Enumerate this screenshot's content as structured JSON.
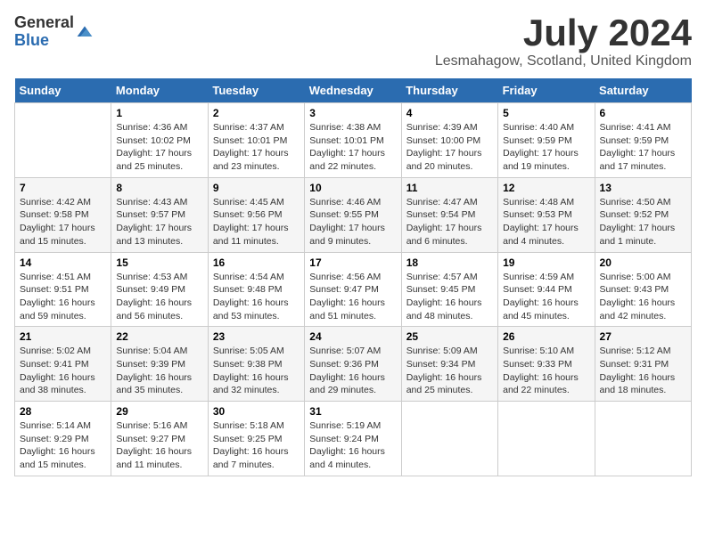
{
  "logo": {
    "general": "General",
    "blue": "Blue"
  },
  "title": "July 2024",
  "location": "Lesmahagow, Scotland, United Kingdom",
  "days_header": [
    "Sunday",
    "Monday",
    "Tuesday",
    "Wednesday",
    "Thursday",
    "Friday",
    "Saturday"
  ],
  "weeks": [
    [
      {
        "day": "",
        "sunrise": "",
        "sunset": "",
        "daylight": ""
      },
      {
        "day": "1",
        "sunrise": "Sunrise: 4:36 AM",
        "sunset": "Sunset: 10:02 PM",
        "daylight": "Daylight: 17 hours and 25 minutes."
      },
      {
        "day": "2",
        "sunrise": "Sunrise: 4:37 AM",
        "sunset": "Sunset: 10:01 PM",
        "daylight": "Daylight: 17 hours and 23 minutes."
      },
      {
        "day": "3",
        "sunrise": "Sunrise: 4:38 AM",
        "sunset": "Sunset: 10:01 PM",
        "daylight": "Daylight: 17 hours and 22 minutes."
      },
      {
        "day": "4",
        "sunrise": "Sunrise: 4:39 AM",
        "sunset": "Sunset: 10:00 PM",
        "daylight": "Daylight: 17 hours and 20 minutes."
      },
      {
        "day": "5",
        "sunrise": "Sunrise: 4:40 AM",
        "sunset": "Sunset: 9:59 PM",
        "daylight": "Daylight: 17 hours and 19 minutes."
      },
      {
        "day": "6",
        "sunrise": "Sunrise: 4:41 AM",
        "sunset": "Sunset: 9:59 PM",
        "daylight": "Daylight: 17 hours and 17 minutes."
      }
    ],
    [
      {
        "day": "7",
        "sunrise": "Sunrise: 4:42 AM",
        "sunset": "Sunset: 9:58 PM",
        "daylight": "Daylight: 17 hours and 15 minutes."
      },
      {
        "day": "8",
        "sunrise": "Sunrise: 4:43 AM",
        "sunset": "Sunset: 9:57 PM",
        "daylight": "Daylight: 17 hours and 13 minutes."
      },
      {
        "day": "9",
        "sunrise": "Sunrise: 4:45 AM",
        "sunset": "Sunset: 9:56 PM",
        "daylight": "Daylight: 17 hours and 11 minutes."
      },
      {
        "day": "10",
        "sunrise": "Sunrise: 4:46 AM",
        "sunset": "Sunset: 9:55 PM",
        "daylight": "Daylight: 17 hours and 9 minutes."
      },
      {
        "day": "11",
        "sunrise": "Sunrise: 4:47 AM",
        "sunset": "Sunset: 9:54 PM",
        "daylight": "Daylight: 17 hours and 6 minutes."
      },
      {
        "day": "12",
        "sunrise": "Sunrise: 4:48 AM",
        "sunset": "Sunset: 9:53 PM",
        "daylight": "Daylight: 17 hours and 4 minutes."
      },
      {
        "day": "13",
        "sunrise": "Sunrise: 4:50 AM",
        "sunset": "Sunset: 9:52 PM",
        "daylight": "Daylight: 17 hours and 1 minute."
      }
    ],
    [
      {
        "day": "14",
        "sunrise": "Sunrise: 4:51 AM",
        "sunset": "Sunset: 9:51 PM",
        "daylight": "Daylight: 16 hours and 59 minutes."
      },
      {
        "day": "15",
        "sunrise": "Sunrise: 4:53 AM",
        "sunset": "Sunset: 9:49 PM",
        "daylight": "Daylight: 16 hours and 56 minutes."
      },
      {
        "day": "16",
        "sunrise": "Sunrise: 4:54 AM",
        "sunset": "Sunset: 9:48 PM",
        "daylight": "Daylight: 16 hours and 53 minutes."
      },
      {
        "day": "17",
        "sunrise": "Sunrise: 4:56 AM",
        "sunset": "Sunset: 9:47 PM",
        "daylight": "Daylight: 16 hours and 51 minutes."
      },
      {
        "day": "18",
        "sunrise": "Sunrise: 4:57 AM",
        "sunset": "Sunset: 9:45 PM",
        "daylight": "Daylight: 16 hours and 48 minutes."
      },
      {
        "day": "19",
        "sunrise": "Sunrise: 4:59 AM",
        "sunset": "Sunset: 9:44 PM",
        "daylight": "Daylight: 16 hours and 45 minutes."
      },
      {
        "day": "20",
        "sunrise": "Sunrise: 5:00 AM",
        "sunset": "Sunset: 9:43 PM",
        "daylight": "Daylight: 16 hours and 42 minutes."
      }
    ],
    [
      {
        "day": "21",
        "sunrise": "Sunrise: 5:02 AM",
        "sunset": "Sunset: 9:41 PM",
        "daylight": "Daylight: 16 hours and 38 minutes."
      },
      {
        "day": "22",
        "sunrise": "Sunrise: 5:04 AM",
        "sunset": "Sunset: 9:39 PM",
        "daylight": "Daylight: 16 hours and 35 minutes."
      },
      {
        "day": "23",
        "sunrise": "Sunrise: 5:05 AM",
        "sunset": "Sunset: 9:38 PM",
        "daylight": "Daylight: 16 hours and 32 minutes."
      },
      {
        "day": "24",
        "sunrise": "Sunrise: 5:07 AM",
        "sunset": "Sunset: 9:36 PM",
        "daylight": "Daylight: 16 hours and 29 minutes."
      },
      {
        "day": "25",
        "sunrise": "Sunrise: 5:09 AM",
        "sunset": "Sunset: 9:34 PM",
        "daylight": "Daylight: 16 hours and 25 minutes."
      },
      {
        "day": "26",
        "sunrise": "Sunrise: 5:10 AM",
        "sunset": "Sunset: 9:33 PM",
        "daylight": "Daylight: 16 hours and 22 minutes."
      },
      {
        "day": "27",
        "sunrise": "Sunrise: 5:12 AM",
        "sunset": "Sunset: 9:31 PM",
        "daylight": "Daylight: 16 hours and 18 minutes."
      }
    ],
    [
      {
        "day": "28",
        "sunrise": "Sunrise: 5:14 AM",
        "sunset": "Sunset: 9:29 PM",
        "daylight": "Daylight: 16 hours and 15 minutes."
      },
      {
        "day": "29",
        "sunrise": "Sunrise: 5:16 AM",
        "sunset": "Sunset: 9:27 PM",
        "daylight": "Daylight: 16 hours and 11 minutes."
      },
      {
        "day": "30",
        "sunrise": "Sunrise: 5:18 AM",
        "sunset": "Sunset: 9:25 PM",
        "daylight": "Daylight: 16 hours and 7 minutes."
      },
      {
        "day": "31",
        "sunrise": "Sunrise: 5:19 AM",
        "sunset": "Sunset: 9:24 PM",
        "daylight": "Daylight: 16 hours and 4 minutes."
      },
      {
        "day": "",
        "sunrise": "",
        "sunset": "",
        "daylight": ""
      },
      {
        "day": "",
        "sunrise": "",
        "sunset": "",
        "daylight": ""
      },
      {
        "day": "",
        "sunrise": "",
        "sunset": "",
        "daylight": ""
      }
    ]
  ]
}
